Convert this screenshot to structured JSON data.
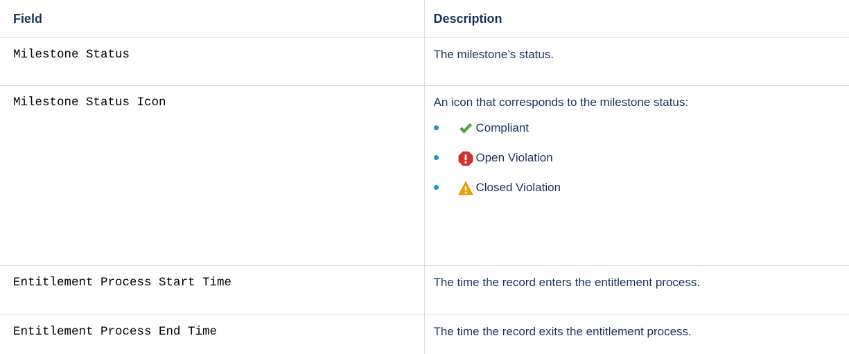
{
  "table": {
    "headers": {
      "field": "Field",
      "description": "Description"
    },
    "rows": [
      {
        "field": "Milestone Status",
        "description": "The milestone’s status."
      },
      {
        "field": "Milestone Status Icon",
        "description": "An icon that corresponds to the milestone status:",
        "status_items": [
          {
            "icon": "check-icon",
            "label": "Compliant",
            "color": "#4caf32"
          },
          {
            "icon": "error-stop-icon",
            "label": "Open Violation",
            "color": "#d9322c"
          },
          {
            "icon": "warning-triangle-icon",
            "label": "Closed Violation",
            "color": "#f5a000"
          }
        ]
      },
      {
        "field": "Entitlement Process Start Time",
        "description": "The time the record enters the entitlement process."
      },
      {
        "field": "Entitlement Process End Time",
        "description": "The time the record exits the entitlement process."
      }
    ]
  },
  "colors": {
    "heading_text": "#16325c",
    "bullet": "#1798c1",
    "divider": "#d8dde6"
  }
}
